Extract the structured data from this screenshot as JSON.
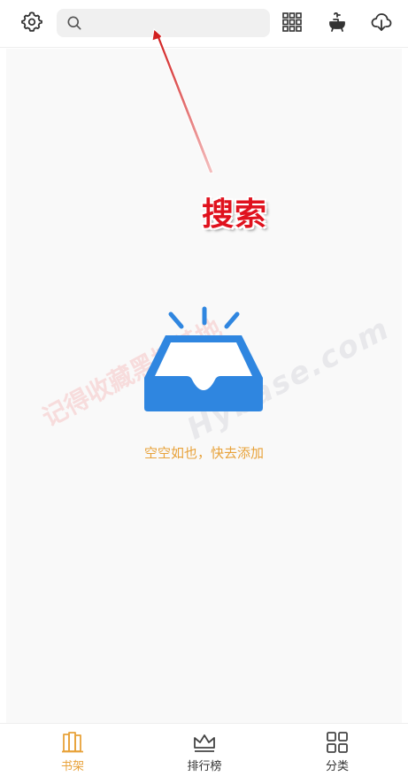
{
  "header": {
    "search_placeholder": "",
    "icons": [
      "gear-icon",
      "search-icon",
      "grid-icon",
      "bathtub-icon",
      "cloud-download-icon"
    ]
  },
  "annotation": {
    "label": "搜索",
    "color": "#e0121e"
  },
  "empty_state": {
    "message": "空空如也，快去添加",
    "icon": "empty-inbox-icon",
    "icon_color": "#2f86e0",
    "text_color": "#e8a23a"
  },
  "watermark": {
    "text": "记得收藏黑域基地",
    "site": "Hybase.com"
  },
  "bottom_nav": {
    "items": [
      {
        "label": "书架",
        "icon": "bookshelf-icon",
        "active": true
      },
      {
        "label": "排行榜",
        "icon": "crown-icon",
        "active": false
      },
      {
        "label": "分类",
        "icon": "category-grid-icon",
        "active": false
      }
    ],
    "active_color": "#e8a23a"
  }
}
